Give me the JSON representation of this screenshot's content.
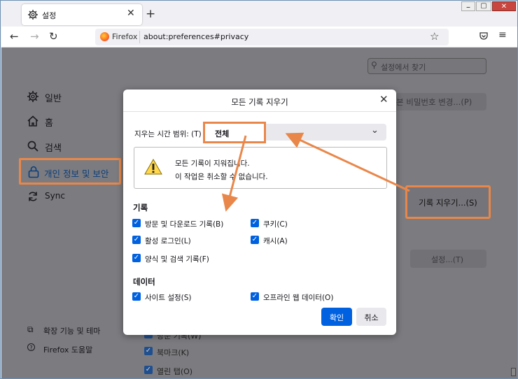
{
  "browser": {
    "tab_title": "설정",
    "identity_label": "Firefox",
    "url": "about:preferences#privacy"
  },
  "page": {
    "search_placeholder": "설정에서 찾기",
    "sidebar": [
      {
        "label": "일반",
        "icon": "gear-icon"
      },
      {
        "label": "홈",
        "icon": "home-icon"
      },
      {
        "label": "검색",
        "icon": "search-icon"
      },
      {
        "label": "개인 정보 및 보안",
        "icon": "lock-icon",
        "active": true
      },
      {
        "label": "Sync",
        "icon": "sync-icon"
      }
    ],
    "sidebar_bottom": [
      {
        "label": "확장 기능 및 테마",
        "icon": "puzzle-icon"
      },
      {
        "label": "Firefox 도움말",
        "icon": "help-icon"
      }
    ],
    "bg_password_button": "본 비밀번호 변경...(P)",
    "clear_history_button": "기록 지우기...(S)",
    "settings_button": "설정...(T)",
    "bg_checkboxes": [
      "방문 기록(W)",
      "북마크(K)",
      "열린 탭(O)"
    ]
  },
  "dialog": {
    "title": "모든 기록 지우기",
    "range_label": "지우는 시간 범위: (T)",
    "range_value": "전체",
    "warning_line1": "모든 기록이 지워집니다.",
    "warning_line2": "이 작업은 취소할 수 없습니다.",
    "history_heading": "기록",
    "history_items": {
      "browsing": "방문 및 다운로드 기록(B)",
      "cookies": "쿠키(C)",
      "logins": "활성 로그인(L)",
      "cache": "캐시(A)",
      "forms": "양식 및 검색 기록(F)"
    },
    "data_heading": "데이터",
    "data_items": {
      "site_settings": "사이트 설정(S)",
      "offline": "오프라인 웹 데이터(O)"
    },
    "ok_button": "확인",
    "cancel_button": "취소"
  },
  "colors": {
    "accent": "#0061e0",
    "highlight": "#e9874a"
  }
}
